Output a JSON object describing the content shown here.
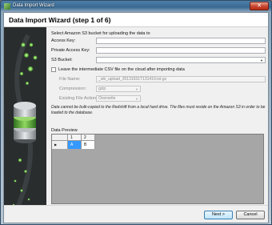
{
  "window": {
    "title": "Data Import Wizard",
    "close_glyph": "✕"
  },
  "header": {
    "title": "Data Import Wizard (step 1 of 6)"
  },
  "form": {
    "intro": "Select Amazon S3 bucket for uploading the data to",
    "access_key_label": "Access Key:",
    "access_key_value": "",
    "private_key_label": "Private Access Key:",
    "private_key_value": "",
    "bucket_label": "S3 Bucket:",
    "bucket_value": "",
    "leave_csv_label": "Leave the intermediate CSV file on the cloud after importing data",
    "leave_csv_checked": false,
    "file_name_label": "File Name:",
    "file_name_value": "_wb_upload_20131031T131419.txt.gz",
    "compression_label": "Compression:",
    "compression_value": "gzip",
    "existing_action_label": "Existing File Action:",
    "existing_action_value": "Overwrite",
    "note": "Data cannot be bulk-copied to the Redshift from a local hard drive. The files must reside on the Amazon S3 in order to be loaded to the database."
  },
  "preview": {
    "label": "Data Preview",
    "columns": [
      "1",
      "2"
    ],
    "rows": [
      [
        "A",
        "B"
      ]
    ],
    "row_indicator": "▶"
  },
  "footer": {
    "next_label": "Next >",
    "cancel_label": "Cancel"
  },
  "colors": {
    "sidebar_bg": "#2a2d2e",
    "accent_green": "#6cc04a",
    "selected_cell": "#3399ff"
  },
  "icons": {
    "sidebar_art": "database-stack-icon",
    "dropdown": "chevron-down-icon"
  }
}
